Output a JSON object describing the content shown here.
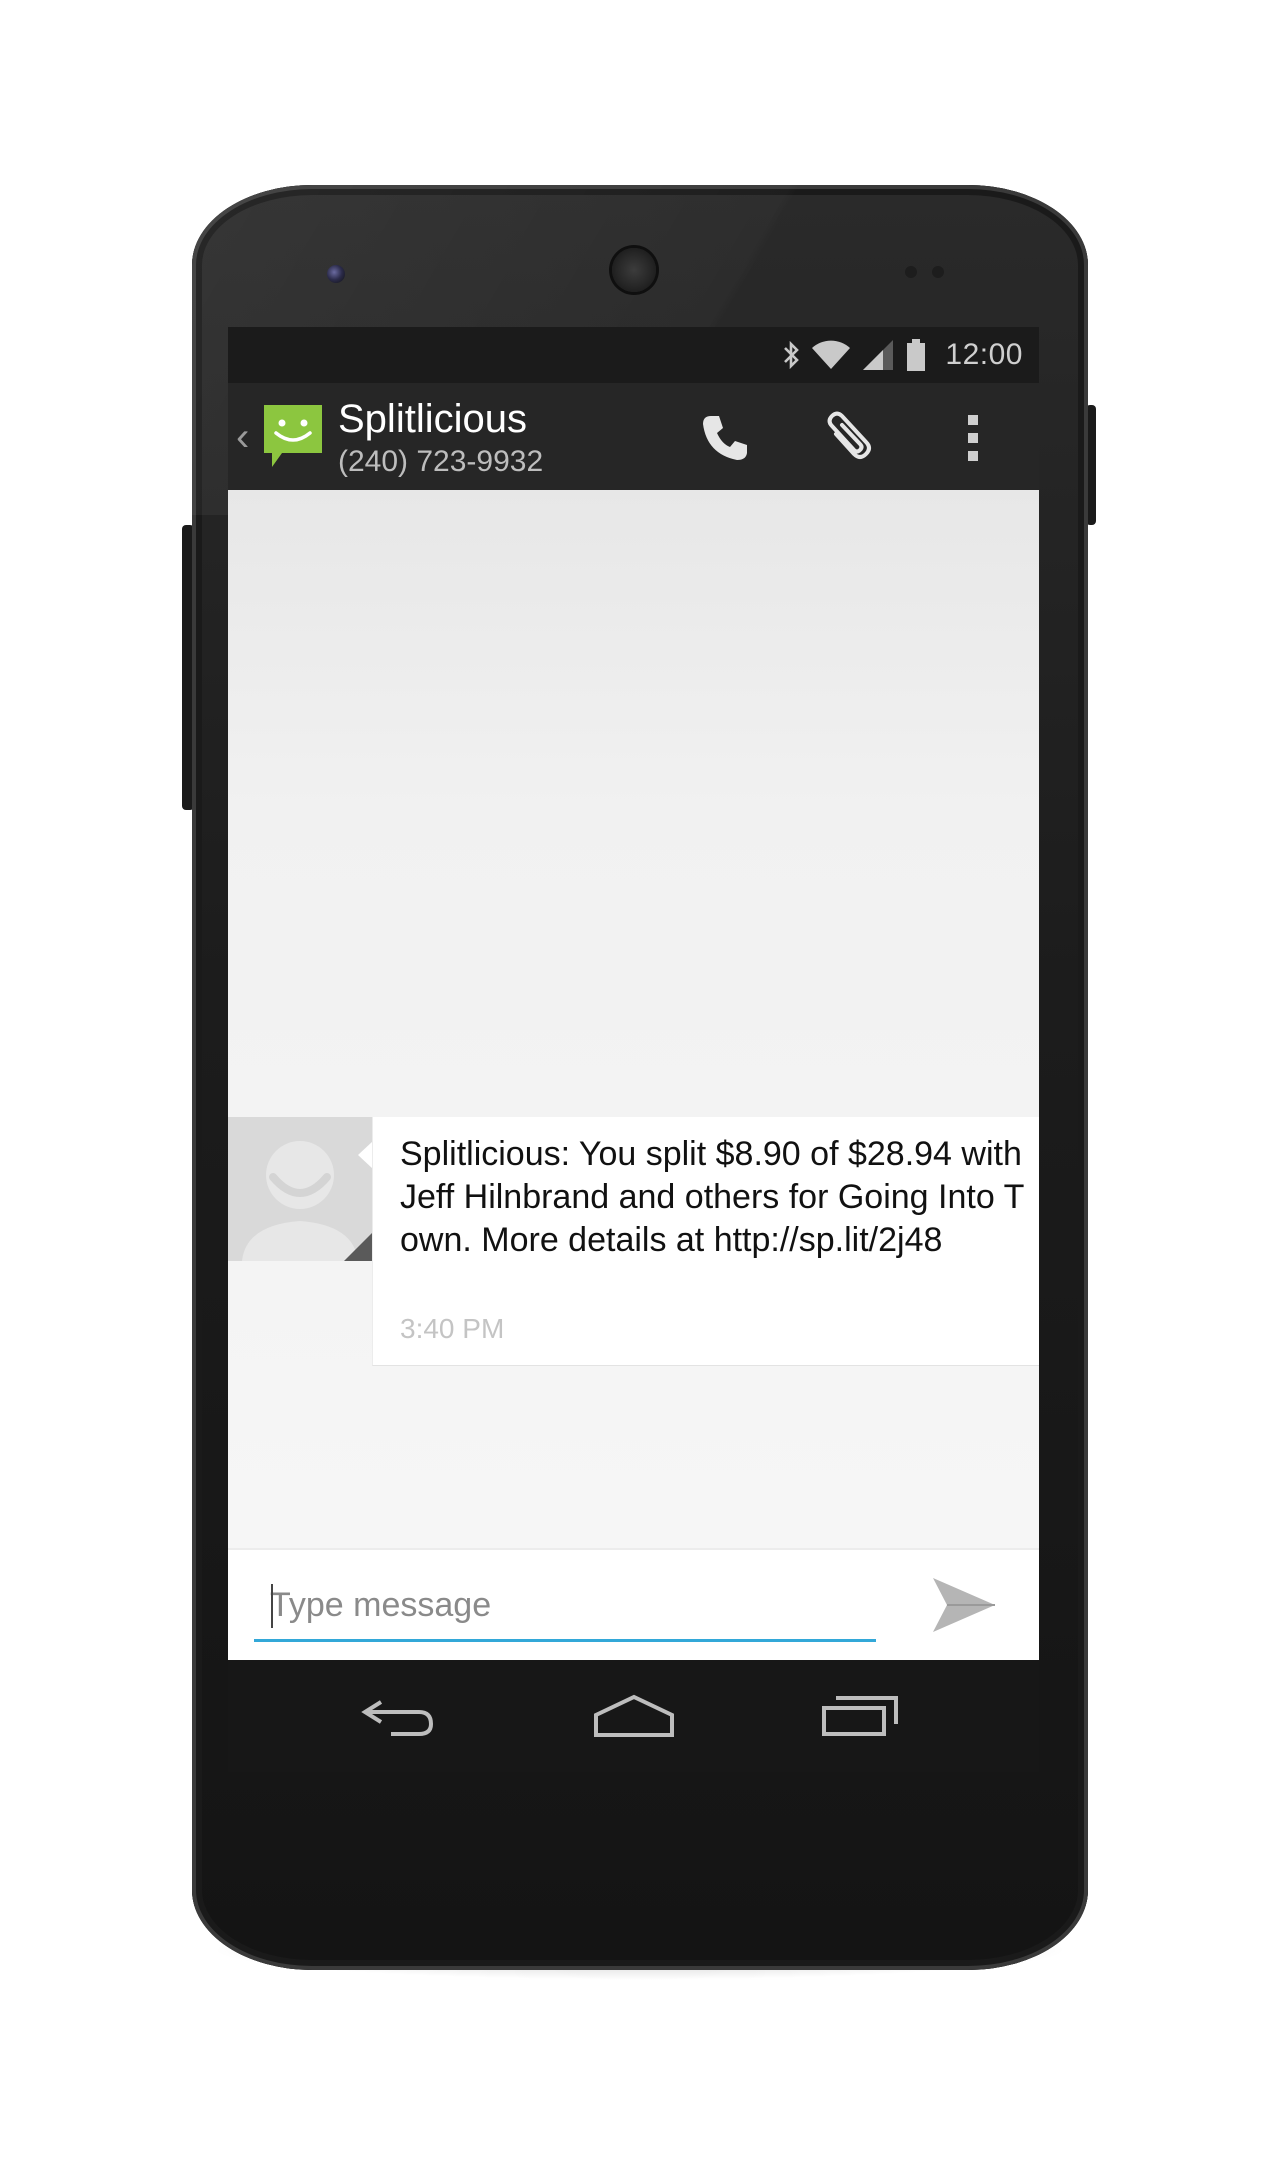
{
  "status_bar": {
    "time": "12:00",
    "icons": [
      "bluetooth-icon",
      "wifi-icon",
      "signal-icon",
      "battery-icon"
    ]
  },
  "action_bar": {
    "back_icon": "chevron-left-icon",
    "app_icon": "messaging-smiley-icon",
    "contact_name": "Splitlicious",
    "contact_number": "(240) 723-9932",
    "actions": [
      "phone-icon",
      "paperclip-icon",
      "overflow-menu-icon"
    ]
  },
  "conversation": {
    "messages": [
      {
        "sender_avatar": "default-contact-avatar",
        "text": "Splitlicious: You split $8.90 of $28.94 with Jeff Hilnbrand and others for Going Into Town. More details at http://sp.lit/2j48",
        "time": "3:40 PM"
      }
    ]
  },
  "compose": {
    "placeholder": "Type message",
    "send_icon": "send-icon"
  },
  "navigation": {
    "buttons": [
      "back-icon",
      "home-icon",
      "recents-icon"
    ]
  },
  "colors": {
    "accent_blue": "#33a8d8",
    "app_green": "#8cc63f",
    "action_bar": "#262626",
    "status_bar": "#1b1b1b"
  }
}
